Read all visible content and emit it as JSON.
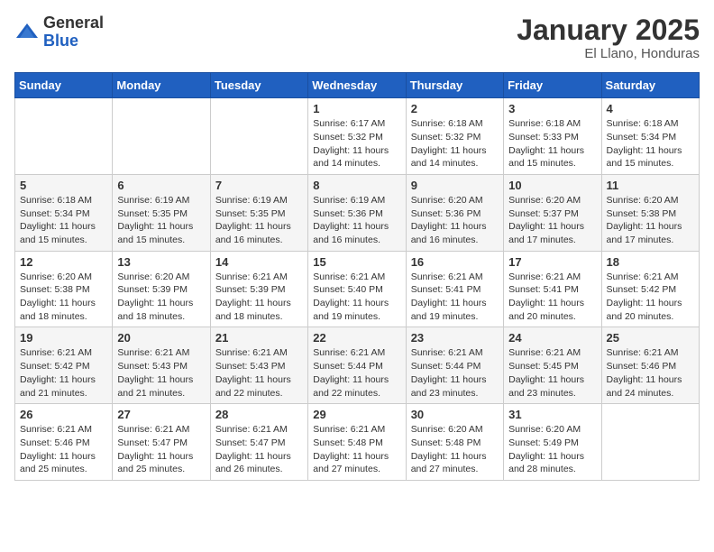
{
  "logo": {
    "general": "General",
    "blue": "Blue"
  },
  "header": {
    "month": "January 2025",
    "location": "El Llano, Honduras"
  },
  "weekdays": [
    "Sunday",
    "Monday",
    "Tuesday",
    "Wednesday",
    "Thursday",
    "Friday",
    "Saturday"
  ],
  "weeks": [
    [
      {
        "day": "",
        "sunrise": "",
        "sunset": "",
        "daylight": ""
      },
      {
        "day": "",
        "sunrise": "",
        "sunset": "",
        "daylight": ""
      },
      {
        "day": "",
        "sunrise": "",
        "sunset": "",
        "daylight": ""
      },
      {
        "day": "1",
        "sunrise": "Sunrise: 6:17 AM",
        "sunset": "Sunset: 5:32 PM",
        "daylight": "Daylight: 11 hours and 14 minutes."
      },
      {
        "day": "2",
        "sunrise": "Sunrise: 6:18 AM",
        "sunset": "Sunset: 5:32 PM",
        "daylight": "Daylight: 11 hours and 14 minutes."
      },
      {
        "day": "3",
        "sunrise": "Sunrise: 6:18 AM",
        "sunset": "Sunset: 5:33 PM",
        "daylight": "Daylight: 11 hours and 15 minutes."
      },
      {
        "day": "4",
        "sunrise": "Sunrise: 6:18 AM",
        "sunset": "Sunset: 5:34 PM",
        "daylight": "Daylight: 11 hours and 15 minutes."
      }
    ],
    [
      {
        "day": "5",
        "sunrise": "Sunrise: 6:18 AM",
        "sunset": "Sunset: 5:34 PM",
        "daylight": "Daylight: 11 hours and 15 minutes."
      },
      {
        "day": "6",
        "sunrise": "Sunrise: 6:19 AM",
        "sunset": "Sunset: 5:35 PM",
        "daylight": "Daylight: 11 hours and 15 minutes."
      },
      {
        "day": "7",
        "sunrise": "Sunrise: 6:19 AM",
        "sunset": "Sunset: 5:35 PM",
        "daylight": "Daylight: 11 hours and 16 minutes."
      },
      {
        "day": "8",
        "sunrise": "Sunrise: 6:19 AM",
        "sunset": "Sunset: 5:36 PM",
        "daylight": "Daylight: 11 hours and 16 minutes."
      },
      {
        "day": "9",
        "sunrise": "Sunrise: 6:20 AM",
        "sunset": "Sunset: 5:36 PM",
        "daylight": "Daylight: 11 hours and 16 minutes."
      },
      {
        "day": "10",
        "sunrise": "Sunrise: 6:20 AM",
        "sunset": "Sunset: 5:37 PM",
        "daylight": "Daylight: 11 hours and 17 minutes."
      },
      {
        "day": "11",
        "sunrise": "Sunrise: 6:20 AM",
        "sunset": "Sunset: 5:38 PM",
        "daylight": "Daylight: 11 hours and 17 minutes."
      }
    ],
    [
      {
        "day": "12",
        "sunrise": "Sunrise: 6:20 AM",
        "sunset": "Sunset: 5:38 PM",
        "daylight": "Daylight: 11 hours and 18 minutes."
      },
      {
        "day": "13",
        "sunrise": "Sunrise: 6:20 AM",
        "sunset": "Sunset: 5:39 PM",
        "daylight": "Daylight: 11 hours and 18 minutes."
      },
      {
        "day": "14",
        "sunrise": "Sunrise: 6:21 AM",
        "sunset": "Sunset: 5:39 PM",
        "daylight": "Daylight: 11 hours and 18 minutes."
      },
      {
        "day": "15",
        "sunrise": "Sunrise: 6:21 AM",
        "sunset": "Sunset: 5:40 PM",
        "daylight": "Daylight: 11 hours and 19 minutes."
      },
      {
        "day": "16",
        "sunrise": "Sunrise: 6:21 AM",
        "sunset": "Sunset: 5:41 PM",
        "daylight": "Daylight: 11 hours and 19 minutes."
      },
      {
        "day": "17",
        "sunrise": "Sunrise: 6:21 AM",
        "sunset": "Sunset: 5:41 PM",
        "daylight": "Daylight: 11 hours and 20 minutes."
      },
      {
        "day": "18",
        "sunrise": "Sunrise: 6:21 AM",
        "sunset": "Sunset: 5:42 PM",
        "daylight": "Daylight: 11 hours and 20 minutes."
      }
    ],
    [
      {
        "day": "19",
        "sunrise": "Sunrise: 6:21 AM",
        "sunset": "Sunset: 5:42 PM",
        "daylight": "Daylight: 11 hours and 21 minutes."
      },
      {
        "day": "20",
        "sunrise": "Sunrise: 6:21 AM",
        "sunset": "Sunset: 5:43 PM",
        "daylight": "Daylight: 11 hours and 21 minutes."
      },
      {
        "day": "21",
        "sunrise": "Sunrise: 6:21 AM",
        "sunset": "Sunset: 5:43 PM",
        "daylight": "Daylight: 11 hours and 22 minutes."
      },
      {
        "day": "22",
        "sunrise": "Sunrise: 6:21 AM",
        "sunset": "Sunset: 5:44 PM",
        "daylight": "Daylight: 11 hours and 22 minutes."
      },
      {
        "day": "23",
        "sunrise": "Sunrise: 6:21 AM",
        "sunset": "Sunset: 5:44 PM",
        "daylight": "Daylight: 11 hours and 23 minutes."
      },
      {
        "day": "24",
        "sunrise": "Sunrise: 6:21 AM",
        "sunset": "Sunset: 5:45 PM",
        "daylight": "Daylight: 11 hours and 23 minutes."
      },
      {
        "day": "25",
        "sunrise": "Sunrise: 6:21 AM",
        "sunset": "Sunset: 5:46 PM",
        "daylight": "Daylight: 11 hours and 24 minutes."
      }
    ],
    [
      {
        "day": "26",
        "sunrise": "Sunrise: 6:21 AM",
        "sunset": "Sunset: 5:46 PM",
        "daylight": "Daylight: 11 hours and 25 minutes."
      },
      {
        "day": "27",
        "sunrise": "Sunrise: 6:21 AM",
        "sunset": "Sunset: 5:47 PM",
        "daylight": "Daylight: 11 hours and 25 minutes."
      },
      {
        "day": "28",
        "sunrise": "Sunrise: 6:21 AM",
        "sunset": "Sunset: 5:47 PM",
        "daylight": "Daylight: 11 hours and 26 minutes."
      },
      {
        "day": "29",
        "sunrise": "Sunrise: 6:21 AM",
        "sunset": "Sunset: 5:48 PM",
        "daylight": "Daylight: 11 hours and 27 minutes."
      },
      {
        "day": "30",
        "sunrise": "Sunrise: 6:20 AM",
        "sunset": "Sunset: 5:48 PM",
        "daylight": "Daylight: 11 hours and 27 minutes."
      },
      {
        "day": "31",
        "sunrise": "Sunrise: 6:20 AM",
        "sunset": "Sunset: 5:49 PM",
        "daylight": "Daylight: 11 hours and 28 minutes."
      },
      {
        "day": "",
        "sunrise": "",
        "sunset": "",
        "daylight": ""
      }
    ]
  ]
}
